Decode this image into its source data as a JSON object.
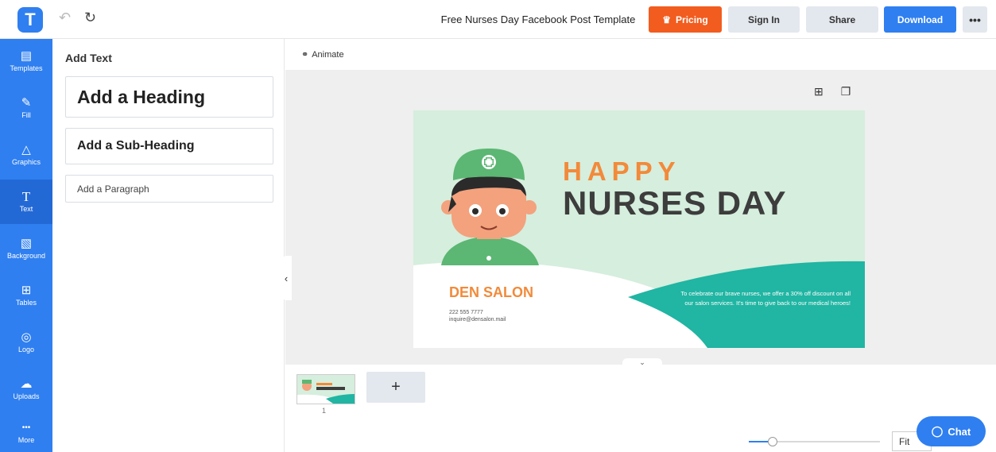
{
  "header": {
    "logo_letter": "T",
    "document_title": "Free Nurses Day Facebook Post Template",
    "pricing_label": "Pricing",
    "signin_label": "Sign In",
    "share_label": "Share",
    "download_label": "Download",
    "more_label": "•••"
  },
  "sidebar": {
    "items": [
      {
        "label": "Templates",
        "icon": "templates-icon",
        "glyph": "▤"
      },
      {
        "label": "Fill",
        "icon": "brush-icon",
        "glyph": "✎"
      },
      {
        "label": "Graphics",
        "icon": "shapes-icon",
        "glyph": "△"
      },
      {
        "label": "Text",
        "icon": "text-icon",
        "glyph": "T"
      },
      {
        "label": "Background",
        "icon": "background-icon",
        "glyph": "▧"
      },
      {
        "label": "Tables",
        "icon": "table-icon",
        "glyph": "⊞"
      },
      {
        "label": "Logo",
        "icon": "logo-icon",
        "glyph": "◎"
      },
      {
        "label": "Uploads",
        "icon": "upload-icon",
        "glyph": "☁"
      },
      {
        "label": "More",
        "icon": "more-icon",
        "glyph": "•••"
      }
    ],
    "active": "Text"
  },
  "panel": {
    "title": "Add Text",
    "heading_label": "Add a Heading",
    "subheading_label": "Add a Sub-Heading",
    "paragraph_label": "Add a Paragraph"
  },
  "toolbar": {
    "animate_label": "Animate"
  },
  "design": {
    "happy": "HAPPY",
    "nurses_day": "NURSES DAY",
    "salon": "DEN SALON",
    "phone": "222 555 7777",
    "email": "inquire@densalon.mail",
    "promo": "To celebrate our brave nurses, we offer a 30% off discount on all our salon services. It's time to give back to our medical heroes!",
    "colors": {
      "background": "#d6eedd",
      "accent": "#f28a3a",
      "teal": "#21b5a3",
      "dark": "#3d3d3d"
    }
  },
  "pages": {
    "thumb_number": "1",
    "add_label": "+"
  },
  "zoom": {
    "fit_label": "Fit",
    "level": 0.18
  },
  "chat": {
    "label": "Chat"
  },
  "colors": {
    "brand_blue": "#2f7ff0",
    "pricing_orange": "#f25c1f"
  }
}
